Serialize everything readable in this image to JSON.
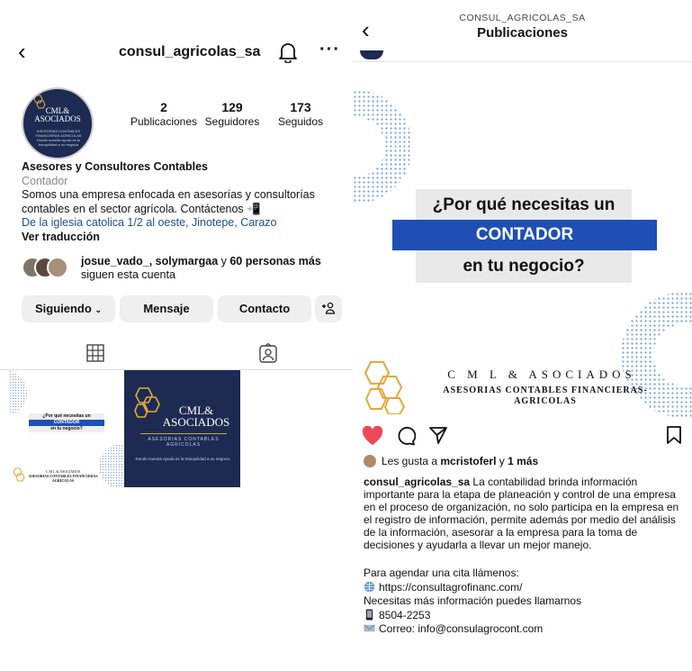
{
  "profile": {
    "username": "consul_agricolas_sa",
    "stats": [
      {
        "value": "2",
        "label": "Publicaciones"
      },
      {
        "value": "129",
        "label": "Seguidores"
      },
      {
        "value": "173",
        "label": "Seguidos"
      }
    ],
    "avatar": {
      "line1": "CML&",
      "line2": "ASOCIADOS",
      "line3": "ASESORIAS CONTABLES FINANCIERAS AGRICOLAS",
      "line4": "Donde nuestra ayuda es la tranquilidad a su negocio"
    },
    "bio_name": "Asesores y Consultores Contables",
    "bio_category": "Contador",
    "bio_text_1": "Somos una empresa enfocada en asesorías y consultorías",
    "bio_text_2": "contables en el sector agrícola. Contáctenos",
    "bio_emoji": "📲",
    "bio_address": "De la iglesia catolica 1/2 al oeste, Jinotepe, Carazo",
    "bio_translate": "Ver traducción",
    "followed_names": "josue_vado_, solymargaa",
    "followed_mid": " y ",
    "followed_more": "60 personas más",
    "followed_tail": "siguen esta cuenta",
    "buttons": {
      "following": "Siguiendo",
      "message": "Mensaje",
      "contact": "Contacto",
      "add": "+"
    },
    "thumb1": {
      "line1": "¿Por qué necesitas un",
      "line2": "CONTADOR",
      "line3": "en tu negocio?",
      "brand": "C M L & ASOCIADOS",
      "brand_sub": "ASESORIAS CONTABLES FINANCIERAS AGRICOLAS"
    },
    "thumb2": {
      "line1": "CML&",
      "line2": "ASOCIADOS",
      "line3": "ASESORIAS CONTABLES",
      "line4": "AGRICOLAS",
      "line5": "Donde nuestra ayuda es la tranquilidad a su negocio"
    }
  },
  "post_view": {
    "header_user": "CONSUL_AGRICOLAS_SA",
    "header_title": "Publicaciones",
    "image": {
      "q1": "¿Por qué necesitas un",
      "q2": "CONTADOR",
      "q3": "en tu negocio?",
      "brand": "C M L & ASOCIADOS",
      "brand_sub_1": "ASESORIAS CONTABLES FINANCIERAS-",
      "brand_sub_2": "AGRICOLAS"
    },
    "likes_prefix": "Les gusta a ",
    "likes_user": "mcristoferl",
    "likes_mid": " y ",
    "likes_more": "1 más",
    "caption_user": "consul_agricolas_sa",
    "caption_text": " La contabilidad brinda información importante para la etapa de planeación y control de una empresa en el proceso de organización, no solo participa en la empresa en el registro de información, permite además por medio del análisis de la información, asesorar a la empresa para la toma de decisiones y ayudarla a llevar un mejor manejo.",
    "contact_line": "Para agendar una cita llámenos:",
    "website": "https://consultagrofinanc.com/",
    "info_line": "Necesitas más información puedes llamarnos",
    "phone": "8504-2253",
    "email": "Correo: info@consulagrocont.com"
  },
  "colors": {
    "navy": "#1d2b52",
    "blue": "#1f4fb4",
    "gold": "#e4a93a",
    "like_red": "#ed4956"
  },
  "icons": [
    "back-arrow-icon",
    "bell-icon",
    "more-dots-icon",
    "grid-icon",
    "tagged-icon",
    "heart-icon",
    "comment-icon",
    "share-icon",
    "bookmark-icon",
    "chevron-down-icon",
    "add-person-icon",
    "globe-icon",
    "phone-icon",
    "mail-icon"
  ]
}
